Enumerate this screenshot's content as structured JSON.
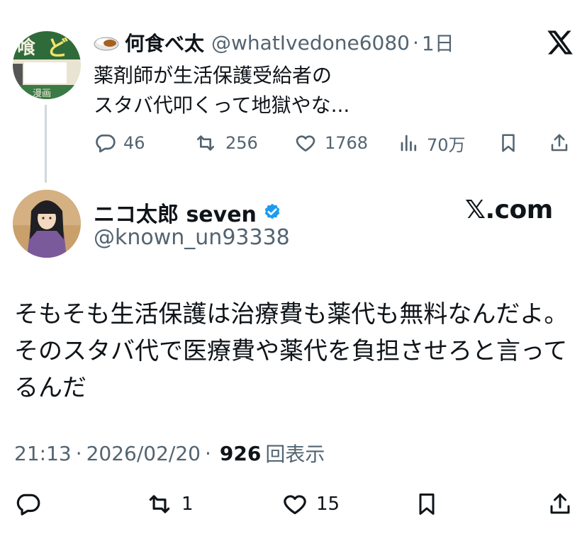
{
  "parent_tweet": {
    "display_name": "何食べ太",
    "handle": "@whatIvedone6080",
    "separator": "·",
    "time": "1日",
    "text": "薬剤師が生活保護受給者の\nスタバ代叩くって地獄やな...",
    "avatar_icon": "manga-avatar",
    "name_emoji_icon": "curry-rice-icon",
    "actions": {
      "replies": "46",
      "retweets": "256",
      "likes": "1768",
      "views": "70万"
    }
  },
  "x_logo_icon": "x-logo-icon",
  "main_tweet": {
    "display_name": "ニコ太郎 seven",
    "verified_icon": "verified-badge-icon",
    "handle": "@known_un93338",
    "watermark": "𝕏.com",
    "avatar_icon": "anime-character-avatar",
    "text": "そもそも生活保護は治療費も薬代も無料なんだよ。\nそのスタバ代で医療費や薬代を負担させろと言って\nるんだ",
    "meta": {
      "time": "21:13",
      "sep1": "·",
      "date": "2026/02/20",
      "sep2": "·",
      "views_count": "926",
      "views_label": "回表示"
    },
    "actions": {
      "retweets": "1",
      "likes": "15"
    }
  },
  "colors": {
    "text": "#0f1419",
    "secondary": "#536471",
    "verified": "#1d9bf0",
    "thread_line": "#cfd9de"
  }
}
